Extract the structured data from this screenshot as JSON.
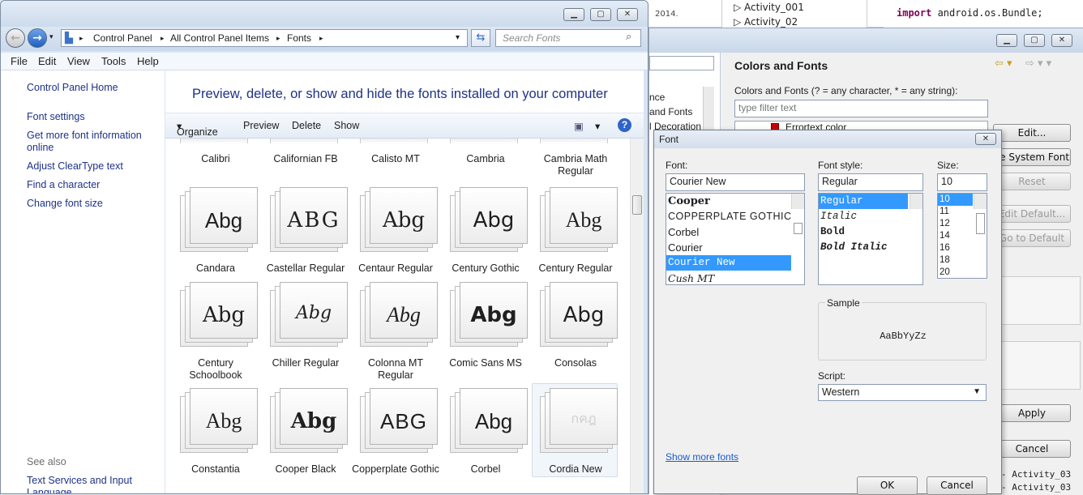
{
  "bg": {
    "year_text": "2014.",
    "tree_items": [
      "Activity_001",
      "Activity_02"
    ],
    "code_line_keyword": "import",
    "code_line_rest": " android.os.Bundle;",
    "bottom_right_items": [
      "Activity_03",
      "Activity_03"
    ]
  },
  "prefs": {
    "title": "Colors and Fonts",
    "description": "Colors and Fonts (? = any character, * = any string):",
    "filter_placeholder": "type filter text",
    "list_item": "Errortext color",
    "left_tree": [
      "nce",
      "and Fonts",
      "l Decoration"
    ],
    "buttons": {
      "edit": "Edit...",
      "use_system_font": "se System Font",
      "reset": "Reset",
      "edit_default": "Edit Default...",
      "go_to_default": "Go to Default",
      "apply": "Apply",
      "cancel": "Cancel"
    }
  },
  "explorer": {
    "breadcrumb": [
      "Control Panel",
      "All Control Panel Items",
      "Fonts"
    ],
    "search_placeholder": "Search Fonts",
    "menu": [
      "File",
      "Edit",
      "View",
      "Tools",
      "Help"
    ],
    "left_links": [
      "Control Panel Home",
      "Font settings",
      "Get more font information online",
      "Adjust ClearType text",
      "Find a character",
      "Change font size"
    ],
    "see_also_label": "See also",
    "see_also_links": [
      "Text Services and Input Language"
    ],
    "heading": "Preview, delete, or show and hide the fonts installed on your computer",
    "commands": [
      "Organize",
      "Preview",
      "Delete",
      "Show"
    ],
    "top_row_labels": [
      "Calibri",
      "Californian FB",
      "Calisto MT",
      "Cambria",
      "Cambria Math Regular"
    ],
    "fonts": [
      {
        "sample": "Abg",
        "label": "Candara"
      },
      {
        "sample": "ABG",
        "label": "Castellar Regular"
      },
      {
        "sample": "Abg",
        "label": "Centaur Regular"
      },
      {
        "sample": "Abg",
        "label": "Century Gothic"
      },
      {
        "sample": "Abg",
        "label": "Century Regular"
      },
      {
        "sample": "Abg",
        "label": "Century Schoolbook"
      },
      {
        "sample": "Abg",
        "label": "Chiller Regular"
      },
      {
        "sample": "Abg",
        "label": "Colonna MT Regular"
      },
      {
        "sample": "Abg",
        "label": "Comic Sans MS"
      },
      {
        "sample": "Abg",
        "label": "Consolas"
      },
      {
        "sample": "Abg",
        "label": "Constantia"
      },
      {
        "sample": "Abg",
        "label": "Cooper Black"
      },
      {
        "sample": "ABG",
        "label": "Copperplate Gothic"
      },
      {
        "sample": "Abg",
        "label": "Corbel"
      },
      {
        "sample": "กคฎ",
        "label": "Cordia New"
      }
    ]
  },
  "font_dialog": {
    "title": "Font",
    "font_label": "Font:",
    "font_value": "Courier New",
    "font_list": [
      "Cooper",
      "COPPERPLATE GOTHIC",
      "Corbel",
      "Courier",
      "Courier New",
      "Cush MT"
    ],
    "font_selected_index": 4,
    "style_label": "Font style:",
    "style_value": "Regular",
    "style_list": [
      "Regular",
      "Italic",
      "Bold",
      "Bold Italic"
    ],
    "size_label": "Size:",
    "size_value": "10",
    "size_list": [
      "10",
      "11",
      "12",
      "14",
      "16",
      "18",
      "20"
    ],
    "sample_label": "Sample",
    "sample_text": "AaBbYyZz",
    "script_label": "Script:",
    "script_value": "Western",
    "show_more_fonts": "Show more fonts",
    "ok": "OK",
    "cancel": "Cancel"
  }
}
